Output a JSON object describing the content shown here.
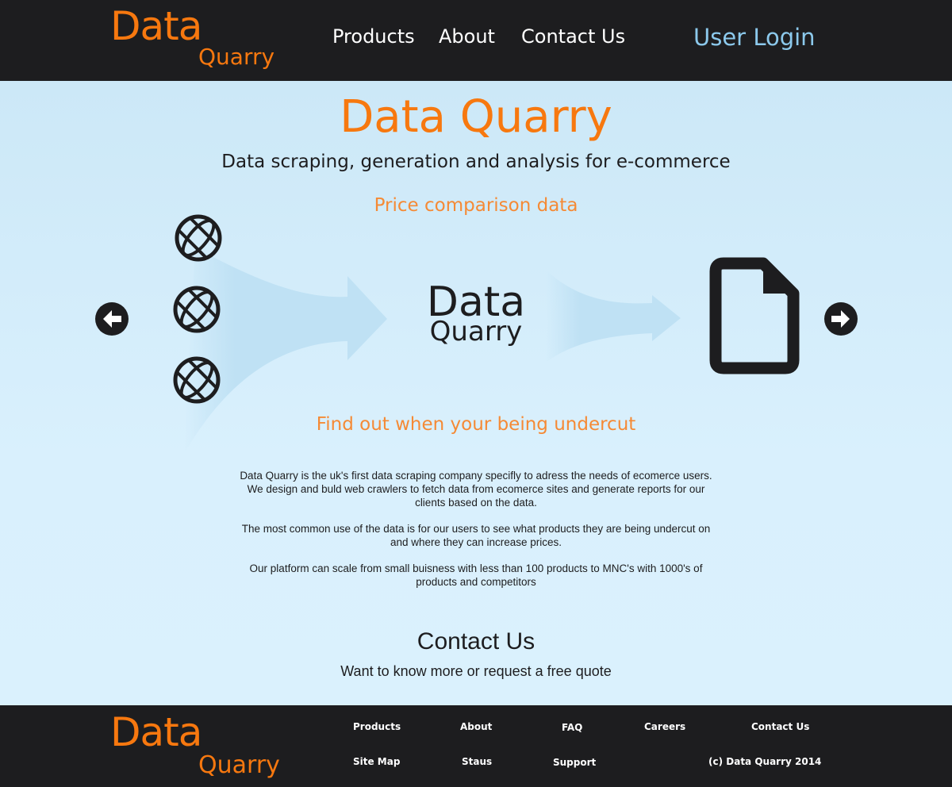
{
  "header": {
    "logo": {
      "word1": "Data",
      "word2": "Quarry"
    },
    "nav": [
      {
        "label": "Products"
      },
      {
        "label": "About"
      },
      {
        "label": "Contact Us"
      }
    ],
    "login_label": "User Login"
  },
  "hero": {
    "title": "Data Quarry",
    "subtitle": "Data scraping, generation and analysis for e-commerce",
    "slide_heading": "Price comparison data",
    "slide_logo": {
      "word1": "Data",
      "word2": "Quarry"
    },
    "prev_icon": "arrow-left-circle-icon",
    "next_icon": "arrow-right-circle-icon",
    "source_icon": "globe-icon",
    "output_icon": "document-icon",
    "tagline": "Find out when your being undercut"
  },
  "about": {
    "paragraphs": [
      "Data Quarry is the uk's first data scraping company specifly to adress the needs of ecomerce users. We design and buld web crawlers to fetch data from ecomerce sites and generate reports for our clients based on the data.",
      "The most common use of the data is for our users to see what products they are being undercut on and where they can increase prices.",
      "Our platform can scale from small buisness with less than 100 products to MNC's with 1000's of products and competitors"
    ]
  },
  "contact": {
    "title": "Contact Us",
    "subtitle": "Want to know more or request a free quote"
  },
  "footer": {
    "logo": {
      "word1": "Data",
      "word2": "Quarry"
    },
    "row1": [
      "Products",
      "About",
      "FAQ",
      "Careers",
      "Contact Us"
    ],
    "row2": [
      "Site Map",
      "Staus",
      "Support"
    ],
    "copyright": "(c) Data Quarry 2014"
  },
  "colors": {
    "brand_orange": "#f7780f",
    "accent_orange": "#f58a35",
    "dark": "#1d1d1f",
    "login_blue": "#8cc9ec",
    "hero_bg": "#d9f0fd",
    "arrow_blue": "#b6dcf1"
  }
}
